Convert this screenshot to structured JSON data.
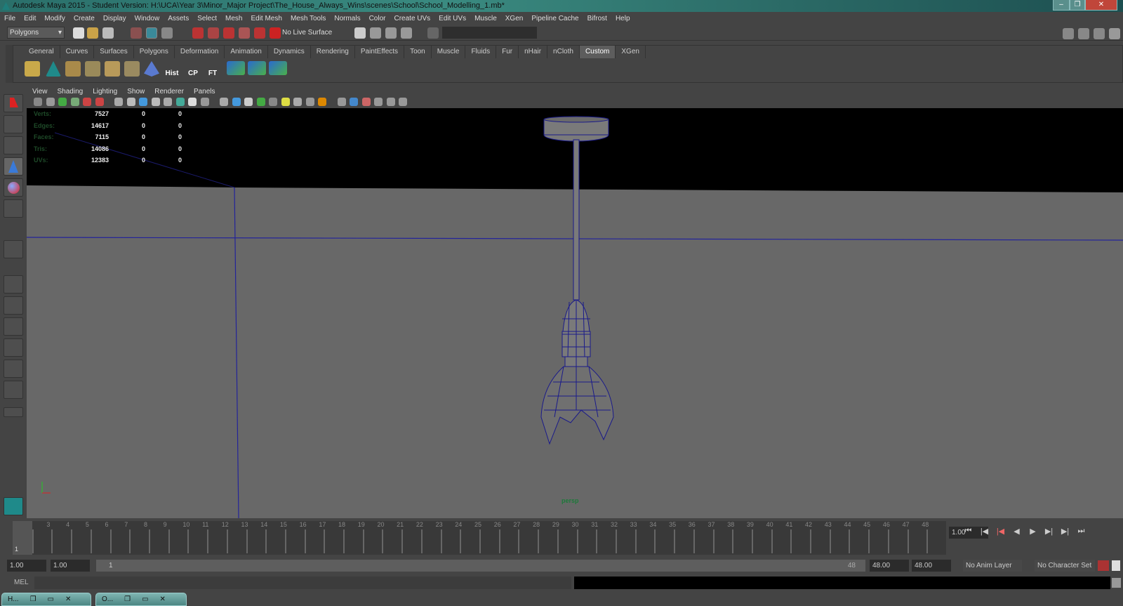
{
  "window": {
    "title": "Autodesk Maya 2015 - Student Version: H:\\UCA\\Year 3\\Minor_Major Project\\The_House_Always_Wins\\scenes\\School\\School_Modelling_1.mb*",
    "controls": [
      "–",
      "❐",
      "✕"
    ]
  },
  "menubar": [
    "File",
    "Edit",
    "Modify",
    "Create",
    "Display",
    "Window",
    "Assets",
    "Select",
    "Mesh",
    "Edit Mesh",
    "Mesh Tools",
    "Normals",
    "Color",
    "Create UVs",
    "Edit UVs",
    "Muscle",
    "XGen",
    "Pipeline Cache",
    "Bifrost",
    "Help"
  ],
  "statusline": {
    "menu_set": "Polygons",
    "live_surface": "No Live Surface",
    "input_field": ""
  },
  "shelf": {
    "tabs": [
      "General",
      "Curves",
      "Surfaces",
      "Polygons",
      "Deformation",
      "Animation",
      "Dynamics",
      "Rendering",
      "PaintEffects",
      "Toon",
      "Muscle",
      "Fluids",
      "Fur",
      "nHair",
      "nCloth",
      "Custom",
      "XGen"
    ],
    "active": "Custom",
    "icon_labels": [
      "Hist",
      "CP",
      "FT"
    ]
  },
  "panel": {
    "menu": [
      "View",
      "Shading",
      "Lighting",
      "Show",
      "Renderer",
      "Panels"
    ],
    "camera": "persp",
    "hud": [
      {
        "label": "Verts:",
        "values": [
          "7527",
          "0",
          "0"
        ]
      },
      {
        "label": "Edges:",
        "values": [
          "14617",
          "0",
          "0"
        ]
      },
      {
        "label": "Faces:",
        "values": [
          "7115",
          "0",
          "0"
        ]
      },
      {
        "label": "Tris:",
        "values": [
          "14086",
          "0",
          "0"
        ]
      },
      {
        "label": "UVs:",
        "values": [
          "12383",
          "0",
          "0"
        ]
      }
    ]
  },
  "timeline": {
    "start": 1,
    "end": 48,
    "current_frame": "1",
    "current_time": "1.00"
  },
  "range": {
    "start_time": "1.00",
    "playback_start": "1.00",
    "slider_start": "1",
    "slider_end": "48",
    "playback_end": "48.00",
    "end_time": "48.00",
    "anim_layer": "No Anim Layer",
    "character_set": "No Character Set"
  },
  "command": {
    "label": "MEL",
    "value": ""
  },
  "taskbar": [
    {
      "label": "H..."
    },
    {
      "label": "O..."
    }
  ],
  "colors": {
    "wireframe": "#1a1a8a",
    "viewport": "#686868",
    "accent": "#5d5d5d"
  }
}
